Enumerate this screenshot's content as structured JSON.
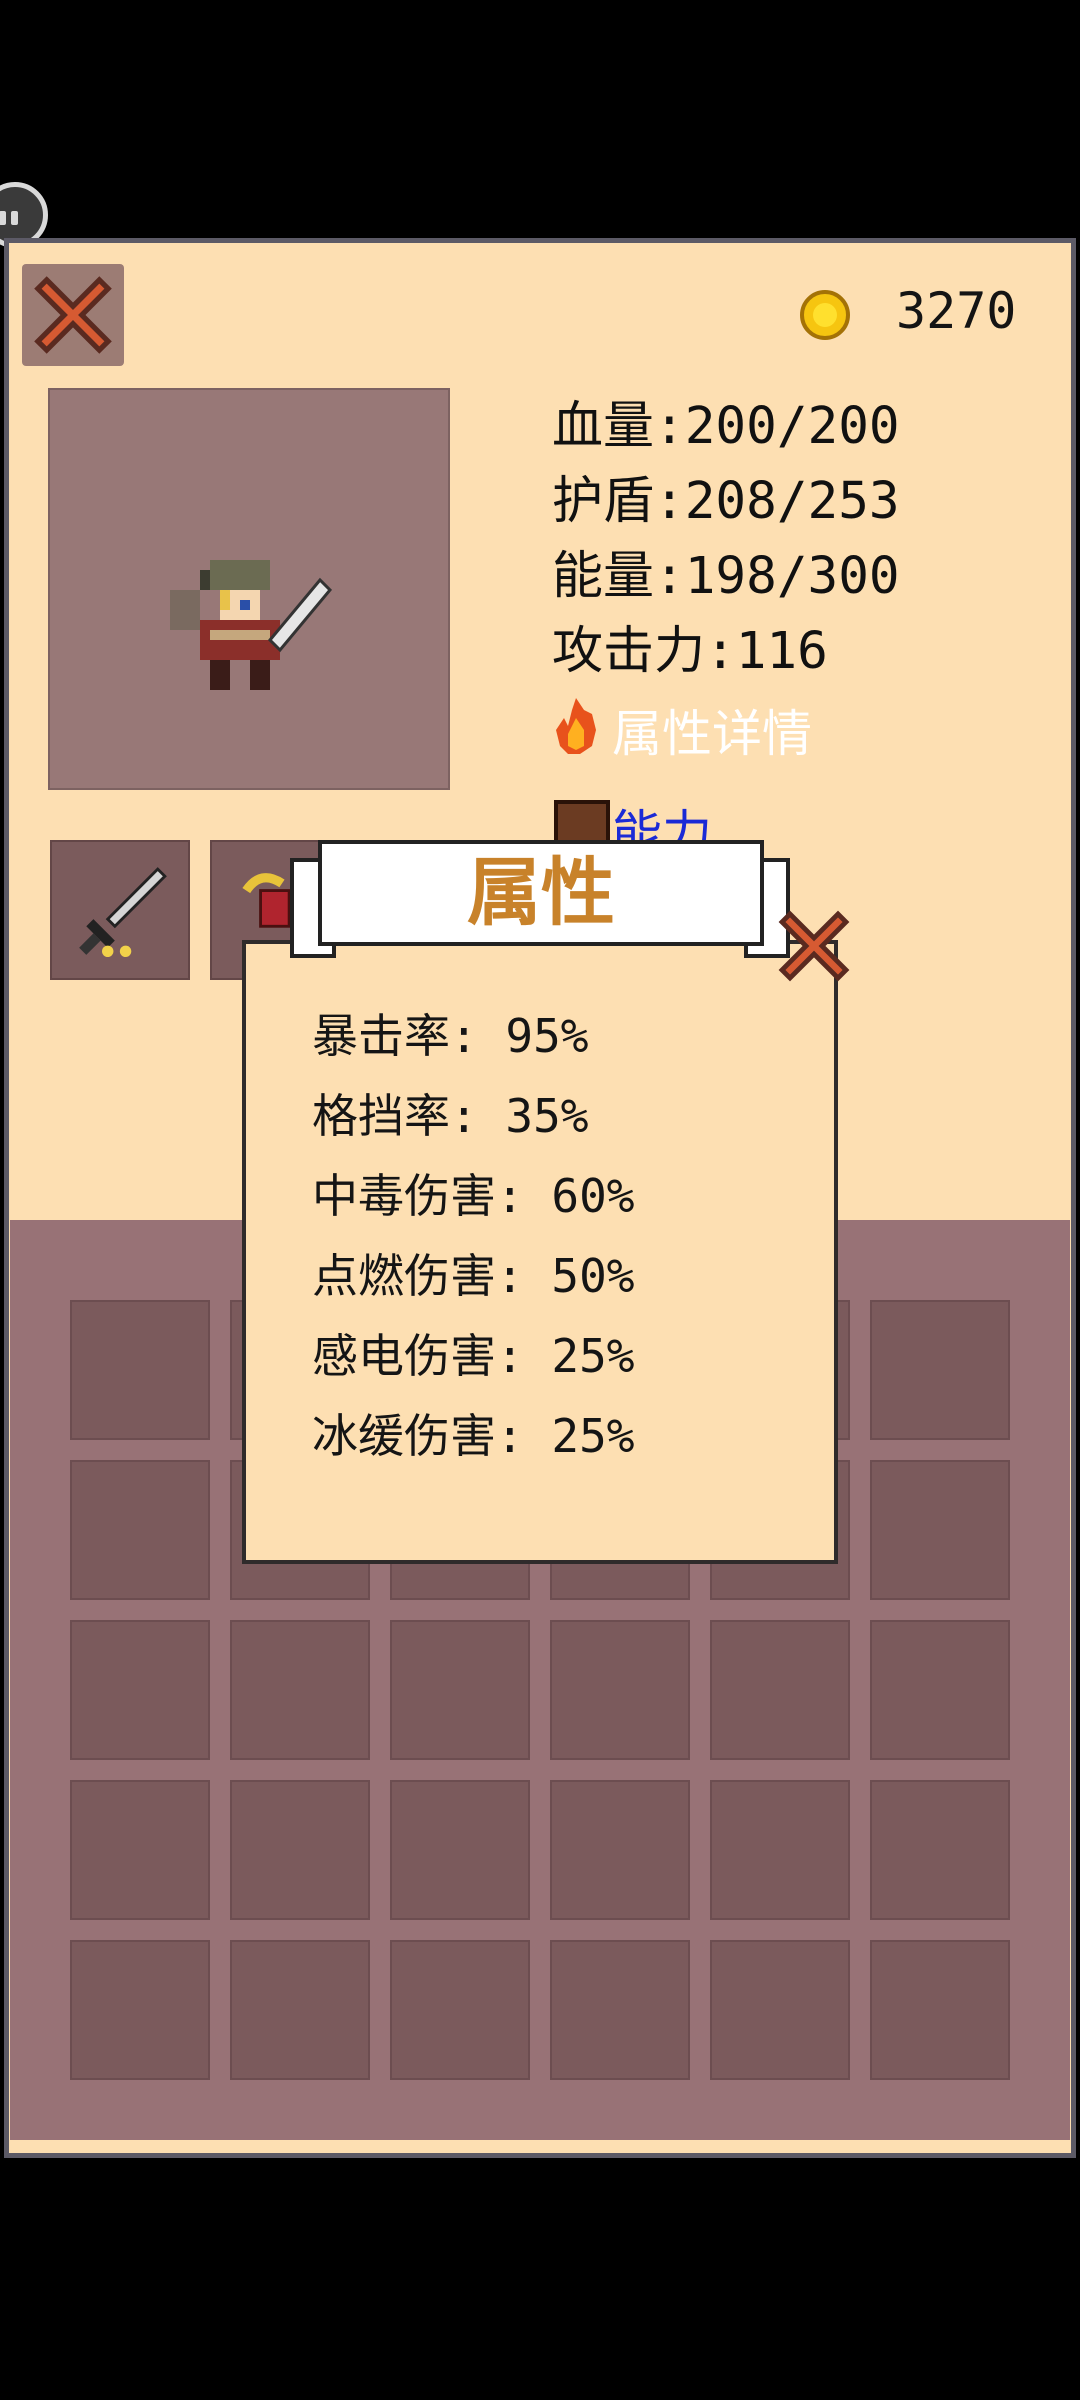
{
  "coins": "3270",
  "stats": {
    "hp": "血量:200/200",
    "shield": "护盾:208/253",
    "energy": "能量:198/300",
    "attack": "攻击力:116"
  },
  "links": {
    "attribute_details": "属性详情",
    "ability": "能力"
  },
  "dialog": {
    "title": "属性",
    "attributes": [
      "暴击率: 95%",
      "格挡率: 35%",
      "中毒伤害: 60%",
      "点燃伤害: 50%",
      "感电伤害: 25%",
      "冰缓伤害: 25%"
    ]
  },
  "colors": {
    "panel": "#fddfb2",
    "slot": "#7b5a5c",
    "title": "#c8822a",
    "link_blue": "#1a2ad6"
  },
  "icons": [
    "close-icon",
    "coin-icon",
    "fire-icon",
    "ability-book-icon",
    "sword-icon",
    "amulet-icon"
  ]
}
